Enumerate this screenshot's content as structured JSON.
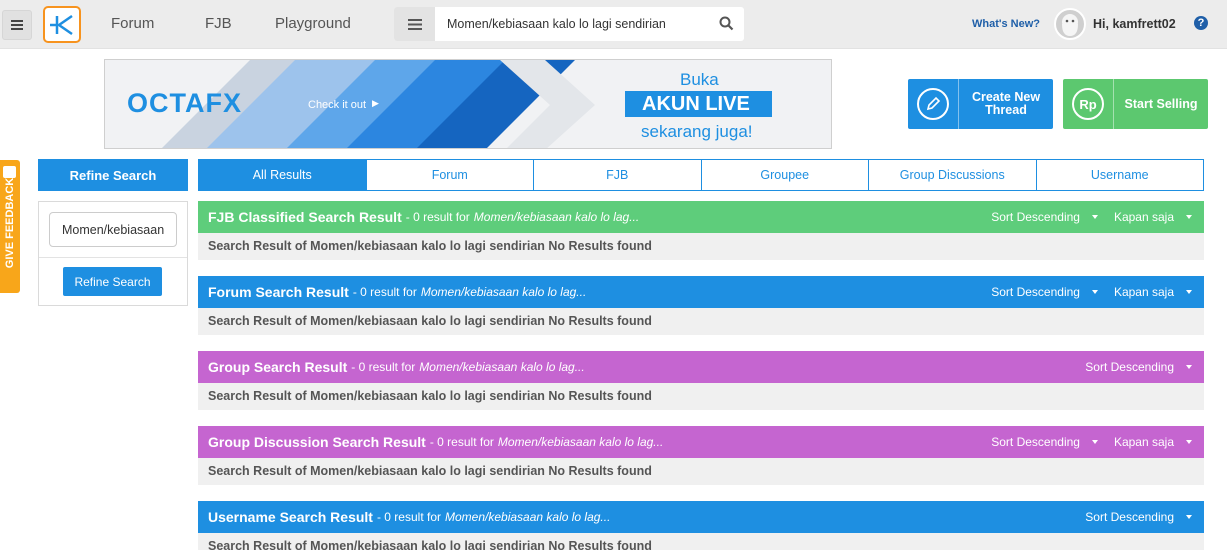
{
  "nav": {
    "forum": "Forum",
    "fjb": "FJB",
    "playground": "Playground"
  },
  "search": {
    "value": "Momen/kebiasaan kalo lo lagi sendirian"
  },
  "header": {
    "whats_new": "What's New?",
    "greeting": "Hi, kamfrett02",
    "help": "?"
  },
  "banner": {
    "brand": "OCTAFX",
    "cta": "Check it out",
    "line1": "Buka",
    "line2": "AKUN LIVE",
    "line3": "sekarang juga!"
  },
  "actions": {
    "create_thread": "Create New Thread",
    "start_selling": "Start Selling",
    "rp_icon": "Rp"
  },
  "feedback": {
    "label": "GIVE FEEDBACK"
  },
  "refine": {
    "title": "Refine Search",
    "input_value": "Momen/kebiasaan",
    "button": "Refine Search"
  },
  "tabs": [
    "All Results",
    "Forum",
    "FJB",
    "Groupee",
    "Group Discussions",
    "Username"
  ],
  "sections": [
    {
      "title": "FJB Classified Search Result",
      "count": "- 0 result for",
      "query": "Momen/kebiasaan kalo lo lag...",
      "sort": "Sort Descending",
      "time": "Kapan saja",
      "body": "Search Result of Momen/kebiasaan kalo lo lagi sendirian No Results found",
      "color": "#5ecd7b"
    },
    {
      "title": "Forum Search Result",
      "count": "- 0 result for",
      "query": "Momen/kebiasaan kalo lo lag...",
      "sort": "Sort Descending",
      "time": "Kapan saja",
      "body": "Search Result of Momen/kebiasaan kalo lo lagi sendirian No Results found",
      "color": "#1e8fe1"
    },
    {
      "title": "Group Search Result",
      "count": "- 0 result for",
      "query": "Momen/kebiasaan kalo lo lag...",
      "sort": "Sort Descending",
      "body": "Search Result of Momen/kebiasaan kalo lo lagi sendirian No Results found",
      "color": "#c565d0"
    },
    {
      "title": "Group Discussion Search Result",
      "count": "- 0 result for",
      "query": "Momen/kebiasaan kalo lo lag...",
      "sort": "Sort Descending",
      "time": "Kapan saja",
      "body": "Search Result of Momen/kebiasaan kalo lo lagi sendirian No Results found",
      "color": "#c565d0"
    },
    {
      "title": "Username Search Result",
      "count": "- 0 result for",
      "query": "Momen/kebiasaan kalo lo lag...",
      "sort": "Sort Descending",
      "body": "Search Result of Momen/kebiasaan kalo lo lagi sendirian No Results found",
      "color": "#1e8fe1"
    }
  ]
}
